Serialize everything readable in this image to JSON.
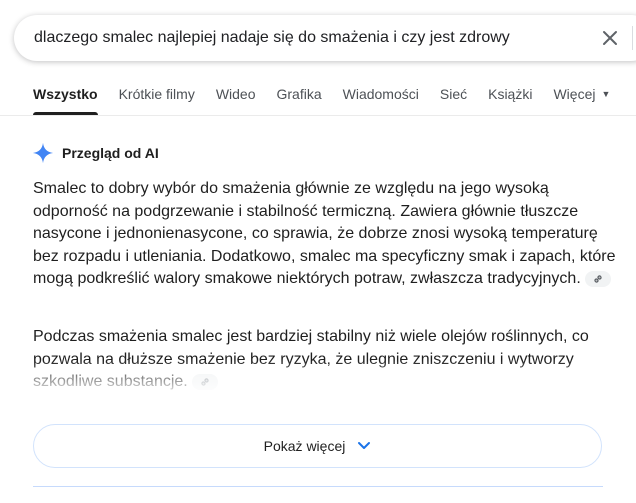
{
  "search": {
    "query": "dlaczego smalec najlepiej nadaje się do smażenia i czy jest zdrowy"
  },
  "tabs": [
    {
      "label": "Wszystko",
      "active": true
    },
    {
      "label": "Krótkie filmy"
    },
    {
      "label": "Wideo"
    },
    {
      "label": "Grafika"
    },
    {
      "label": "Wiadomości"
    },
    {
      "label": "Sieć"
    },
    {
      "label": "Książki"
    },
    {
      "label": "Więcej"
    }
  ],
  "ai_overview": {
    "title": "Przegląd od AI",
    "paragraph1": "Smalec to dobry wybór do smażenia głównie ze względu na jego wysoką odporność na podgrzewanie i stabilność termiczną. Zawiera głównie tłuszcze nasycone i jednonienasycone, co sprawia, że dobrze znosi wysoką temperaturę bez rozpadu i utleniania. Dodatkowo, smalec ma specyficzny smak i zapach, które mogą podkreślić walory smakowe niektórych potraw, zwłaszcza tradycyjnych.",
    "paragraph2": "Podczas smażenia smalec jest bardziej stabilny niż wiele olejów roślinnych, co pozwala na dłuższe smażenie bez ryzyka, że ulegnie zniszczeniu i wytworzy szkodliwe substancje.",
    "show_more_label": "Pokaż więcej"
  },
  "colors": {
    "spark": "#4285f4",
    "show_more_border": "#d2e3fc",
    "text": "#1f1f1f",
    "tab_text": "#4d5156"
  }
}
